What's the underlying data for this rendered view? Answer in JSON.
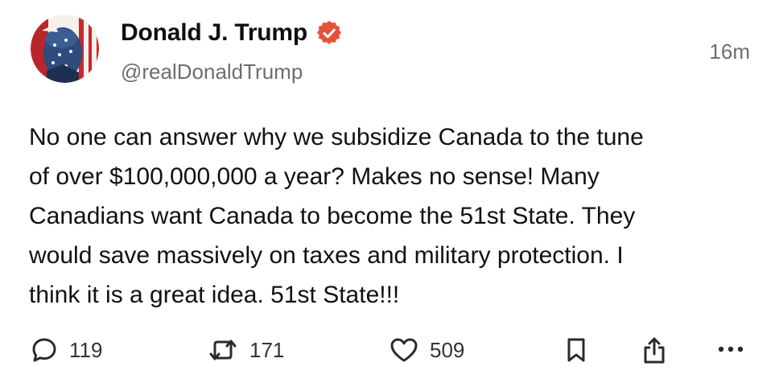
{
  "post": {
    "author_name": "Donald J. Trump",
    "handle": "@realDonaldTrump",
    "timestamp": "16m",
    "verified": true,
    "verified_color": "#e4543b",
    "text": "No one can answer why we subsidize Canada to the tune\nof over $100,000,000 a year? Makes no sense! Many\nCanadians want Canada to become the 51st State. They\nwould save massively on taxes and military protection. I\nthink it is a great idea. 51st State!!!"
  },
  "actions": {
    "reply_count": "119",
    "repost_count": "171",
    "like_count": "509",
    "icons": [
      "reply-icon",
      "repost-icon",
      "like-icon",
      "bookmark-icon",
      "share-icon",
      "more-icon"
    ]
  }
}
